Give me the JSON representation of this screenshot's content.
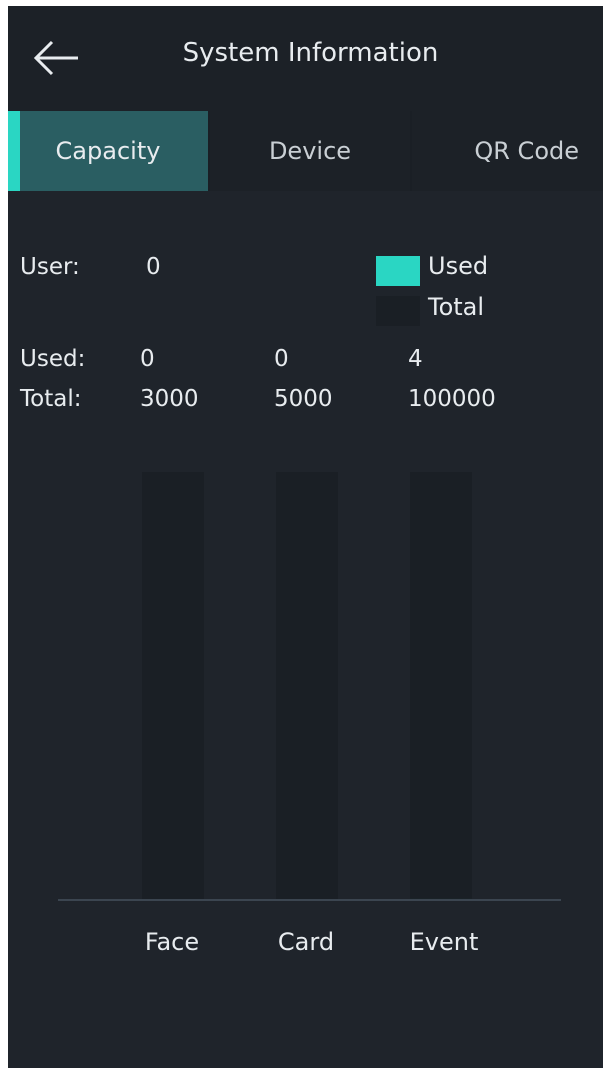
{
  "header": {
    "title": "System Information",
    "back_icon": "arrow-left-icon"
  },
  "tabs": [
    {
      "label": "Capacity",
      "active": true
    },
    {
      "label": "Device",
      "active": false
    },
    {
      "label": "QR Code",
      "active": false
    }
  ],
  "colors": {
    "used": "#2ad6c3",
    "total": "#1a1f25",
    "background": "#1f242b",
    "active_tab": "#2a5e62"
  },
  "capacity": {
    "user_label": "User:",
    "user_value": "0",
    "used_label": "Used:",
    "total_label": "Total:"
  },
  "legend": {
    "used": "Used",
    "total": "Total"
  },
  "chart_data": {
    "type": "bar",
    "categories": [
      "Face",
      "Card",
      "Event"
    ],
    "series": [
      {
        "name": "Used",
        "values": [
          0,
          0,
          4
        ]
      },
      {
        "name": "Total",
        "values": [
          3000,
          5000,
          100000
        ]
      }
    ],
    "used_labels": [
      "0",
      "0",
      "4"
    ],
    "total_labels": [
      "3000",
      "5000",
      "100000"
    ],
    "grid": false,
    "legend_position": "top-right"
  }
}
